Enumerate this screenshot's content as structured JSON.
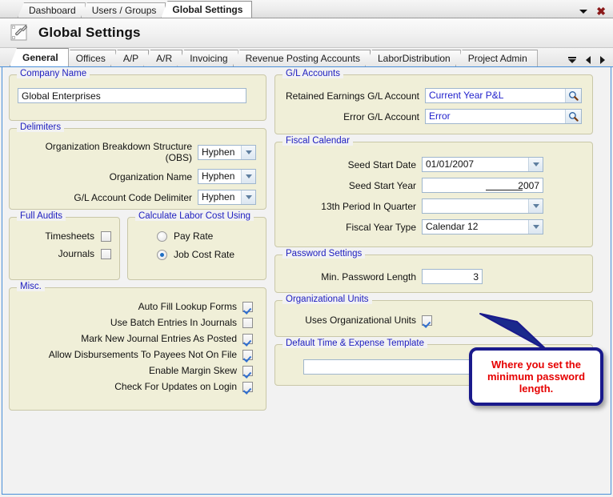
{
  "window": {
    "tabs": [
      {
        "label": "Dashboard",
        "active": false
      },
      {
        "label": "Users / Groups",
        "active": false
      },
      {
        "label": "Global Settings",
        "active": true
      }
    ],
    "dropdown_icon": "caret-down-icon",
    "close_icon": "close-icon"
  },
  "header": {
    "icon": "wrench-tool-icon",
    "title": "Global Settings"
  },
  "tabstrip": {
    "tabs": [
      {
        "label": "General",
        "active": true
      },
      {
        "label": "Offices",
        "active": false
      },
      {
        "label": "A/P",
        "active": false
      },
      {
        "label": "A/R",
        "active": false
      },
      {
        "label": "Invoicing",
        "active": false
      },
      {
        "label": "Revenue Posting Accounts",
        "active": false
      },
      {
        "label": "LaborDistribution",
        "active": false
      },
      {
        "label": "Project Admin",
        "active": false
      }
    ],
    "nav": {
      "list_icon": "tab-list-icon",
      "prev_icon": "arrow-left-icon",
      "next_icon": "arrow-right-icon"
    }
  },
  "company_name": {
    "legend": "Company Name",
    "value": "Global Enterprises"
  },
  "delimiters": {
    "legend": "Delimiters",
    "rows": [
      {
        "label": "Organization Breakdown Structure (OBS)",
        "value": "Hyphen"
      },
      {
        "label": "Organization Name",
        "value": "Hyphen"
      },
      {
        "label": "G/L Account Code Delimiter",
        "value": "Hyphen"
      }
    ]
  },
  "full_audits": {
    "legend": "Full Audits",
    "rows": [
      {
        "label": "Timesheets",
        "checked": false
      },
      {
        "label": "Journals",
        "checked": false
      }
    ]
  },
  "labor_cost": {
    "legend": "Calculate Labor Cost Using",
    "options": [
      {
        "label": "Pay Rate",
        "selected": false
      },
      {
        "label": "Job Cost Rate",
        "selected": true
      }
    ]
  },
  "misc": {
    "legend": "Misc.",
    "rows": [
      {
        "label": "Auto Fill Lookup Forms",
        "checked": true
      },
      {
        "label": "Use Batch Entries In Journals",
        "checked": false
      },
      {
        "label": "Mark New Journal Entries As Posted",
        "checked": true
      },
      {
        "label": "Allow Disbursements To Payees Not On File",
        "checked": true
      },
      {
        "label": "Enable Margin Skew",
        "checked": true
      },
      {
        "label": "Check For Updates on Login",
        "checked": true
      }
    ]
  },
  "gl_accounts": {
    "legend": "G/L Accounts",
    "rows": [
      {
        "label": "Retained Earnings G/L Account",
        "value": "Current Year P&L",
        "icon": "magnifier-icon"
      },
      {
        "label": "Error G/L Account",
        "value": "Error",
        "icon": "magnifier-icon"
      }
    ]
  },
  "fiscal_calendar": {
    "legend": "Fiscal Calendar",
    "seed_start_date": {
      "label": "Seed Start Date",
      "value": "01/01/2007"
    },
    "seed_start_year": {
      "label": "Seed Start Year",
      "value": "2007"
    },
    "thirteenth_period": {
      "label": "13th Period In Quarter",
      "value": ""
    },
    "fiscal_year_type": {
      "label": "Fiscal Year Type",
      "value": "Calendar 12"
    }
  },
  "password_settings": {
    "legend": "Password Settings",
    "min_length": {
      "label": "Min. Password Length",
      "value": "3"
    }
  },
  "organizational_units": {
    "legend": "Organizational Units",
    "uses": {
      "label": "Uses Organizational Units",
      "checked": true
    }
  },
  "time_expense_template": {
    "legend": "Default Time & Expense Template",
    "value": ""
  },
  "callout": {
    "text": "Where you set the minimum password length.",
    "border_color": "#1a1a8c",
    "text_color": "#e60000"
  },
  "colors": {
    "group_background": "#f0efd8",
    "legend_text": "#2020c0",
    "panel_border": "#4a90d9",
    "value_blue": "#2222cc"
  }
}
